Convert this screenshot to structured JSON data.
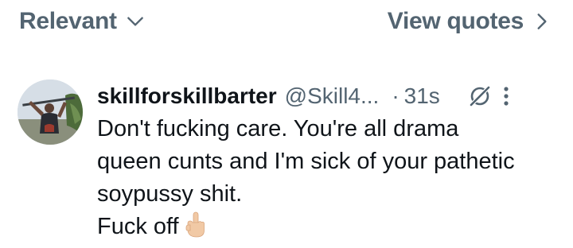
{
  "sort": {
    "label": "Relevant",
    "icon": "chevron-down-icon"
  },
  "quotes_link": {
    "label": "View quotes",
    "icon": "chevron-right-icon"
  },
  "tweet": {
    "display_name": "skillforskillbarter",
    "handle": "@Skill4...",
    "separator": "·",
    "time": "31s",
    "text": "Don't fucking care. You're all drama\nqueen cunts and I'm sick of your pathetic\nsoypussy shit.\nFuck off",
    "emoji_icon": "middle-finger-icon",
    "action_icons": [
      "grok-icon",
      "more-options-icon"
    ]
  },
  "colors": {
    "text": "#0f1419",
    "secondary": "#536471",
    "background": "#ffffff"
  }
}
